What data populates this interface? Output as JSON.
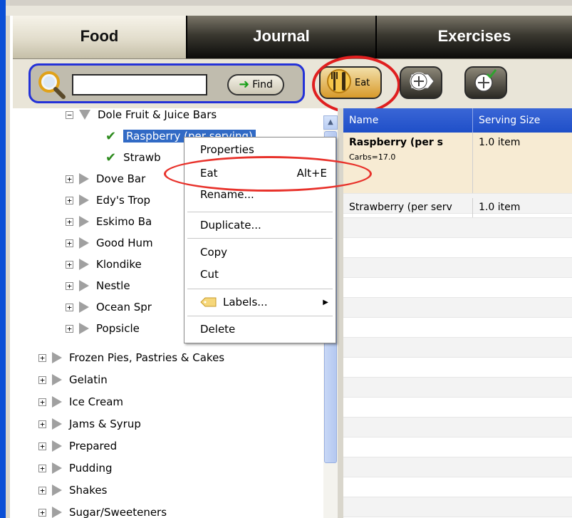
{
  "tabs": [
    {
      "label": "Food",
      "active": true
    },
    {
      "label": "Journal",
      "active": false
    },
    {
      "label": "Exercises",
      "active": false
    }
  ],
  "toolbar": {
    "search_value": "",
    "find_label": "Find",
    "eat_label": "Eat"
  },
  "tree": {
    "group": "Dole Fruit & Juice Bars",
    "children": [
      "Raspberry (per serving)",
      "Strawb"
    ],
    "brands": [
      "Dove Bar",
      "Edy's Trop",
      "Eskimo Ba",
      "Good Hum",
      "Klondike",
      "Nestle",
      "Ocean Spr",
      "Popsicle"
    ],
    "categories": [
      "Frozen Pies, Pastries & Cakes",
      "Gelatin",
      "Ice Cream",
      "Jams & Syrup",
      "Prepared",
      "Pudding",
      "Shakes",
      "Sugar/Sweeteners"
    ]
  },
  "grid": {
    "headers": {
      "name": "Name",
      "serving": "Serving Size"
    },
    "rows": [
      {
        "name": "Raspberry (per s",
        "serving": "1.0 item",
        "sub": "Carbs=17.0"
      },
      {
        "name": "Strawberry (per serv",
        "serving": "1.0 item"
      }
    ]
  },
  "context_menu": {
    "properties": "Properties",
    "eat": "Eat",
    "eat_shortcut": "Alt+E",
    "rename": "Rename...",
    "duplicate": "Duplicate...",
    "copy": "Copy",
    "cut": "Cut",
    "labels": "Labels...",
    "delete": "Delete"
  },
  "colors": {
    "selection": "#316ac5",
    "highlight_circle": "#e01f1f",
    "search_border": "#2432d8"
  }
}
